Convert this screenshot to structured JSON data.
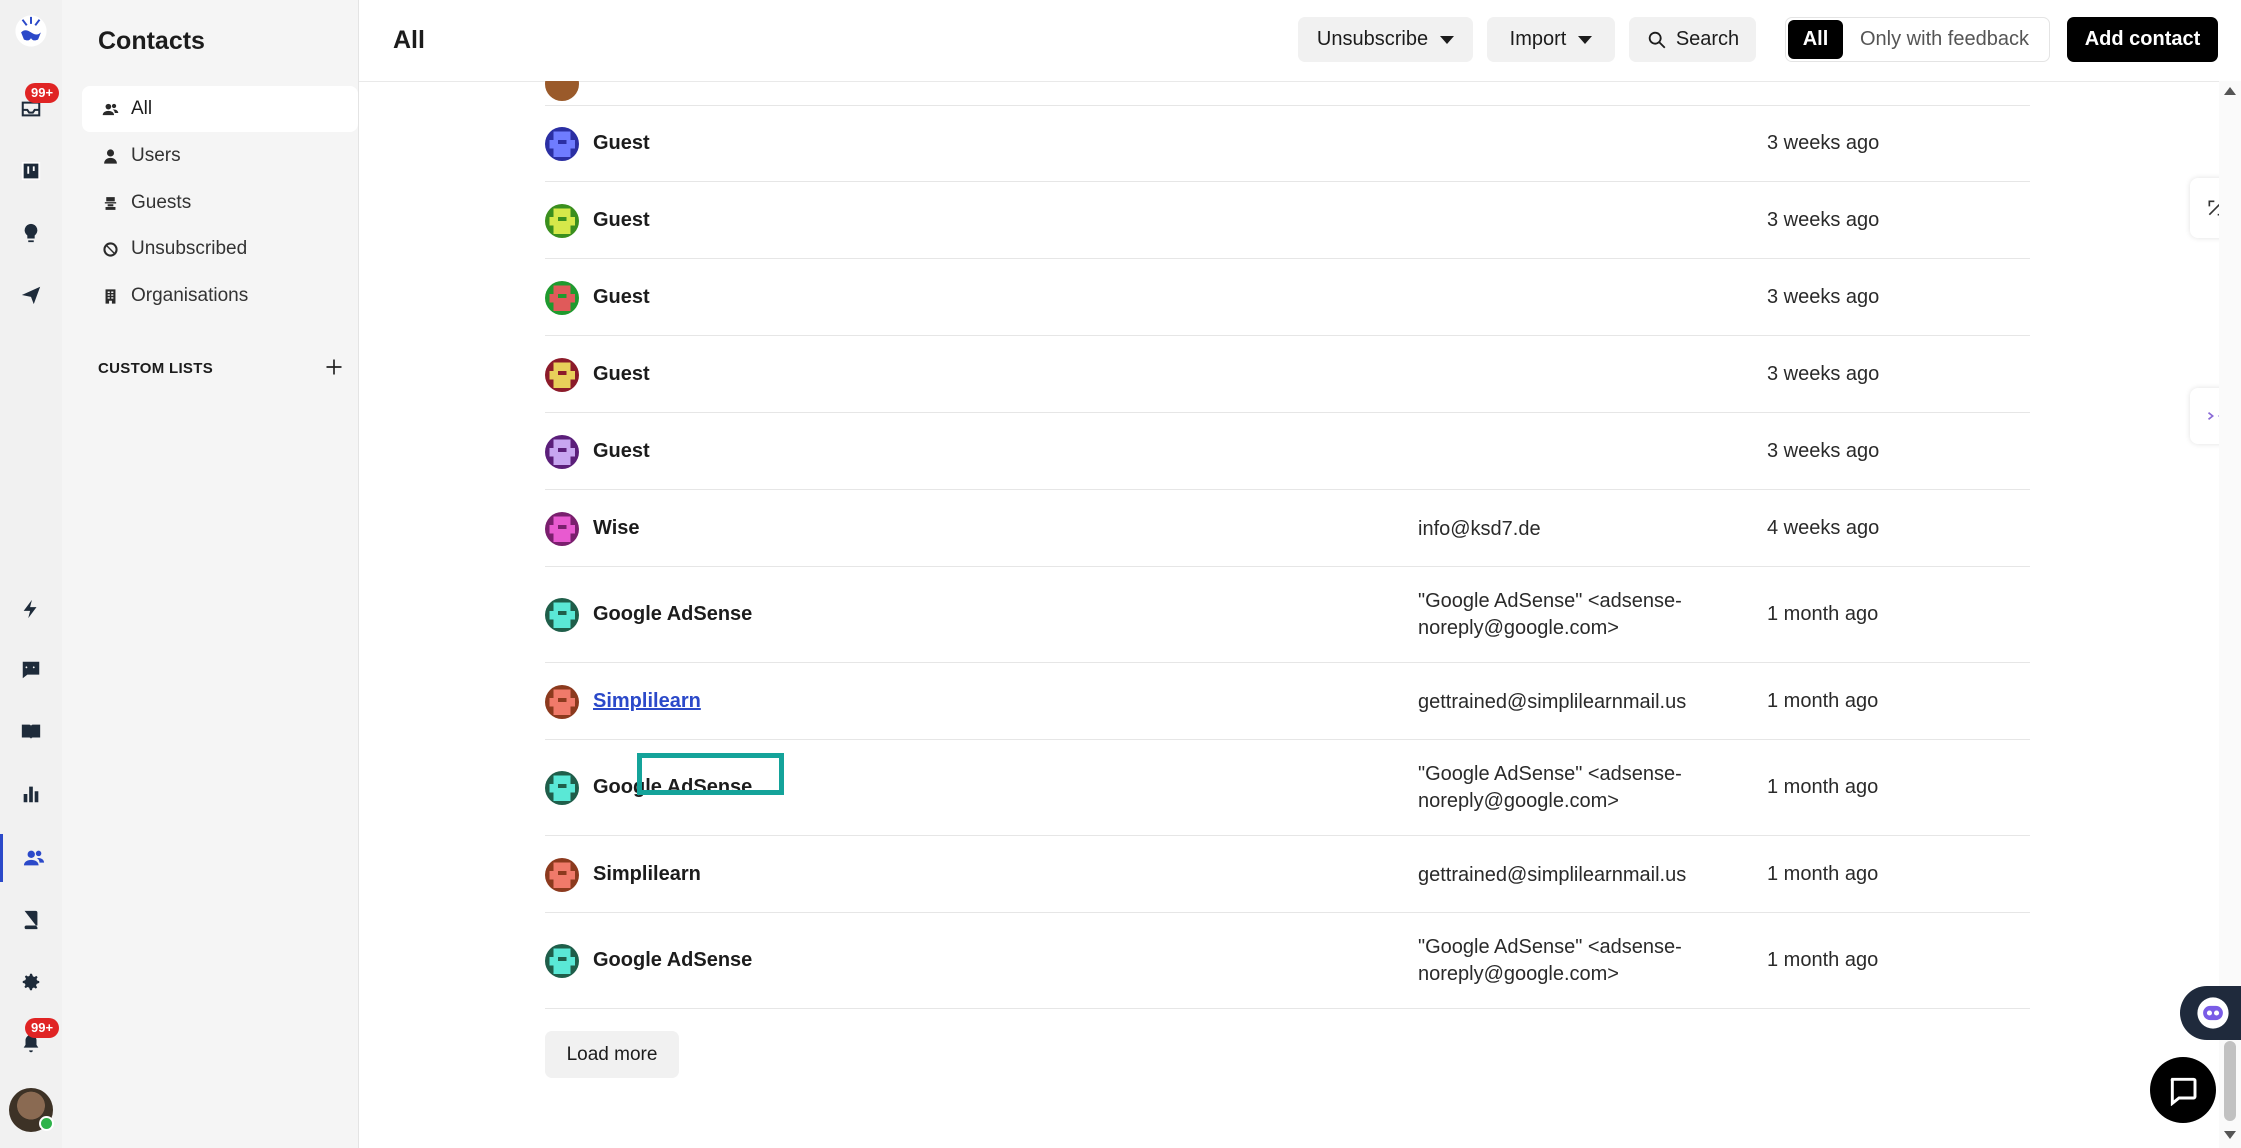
{
  "rail": {
    "inbox_badge": "99+",
    "notifications_badge": "99+"
  },
  "sidebar": {
    "title": "Contacts",
    "items": [
      {
        "label": "All"
      },
      {
        "label": "Users"
      },
      {
        "label": "Guests"
      },
      {
        "label": "Unsubscribed"
      },
      {
        "label": "Organisations"
      }
    ],
    "custom_lists_label": "CUSTOM LISTS"
  },
  "header": {
    "title": "All",
    "unsubscribe_label": "Unsubscribe",
    "import_label": "Import",
    "search_label": "Search",
    "filter_all": "All",
    "filter_feedback": "Only with feedback",
    "add_contact_label": "Add contact"
  },
  "contacts": [
    {
      "name": "Guest",
      "email": "",
      "time": "3 weeks ago",
      "avatar_bg": "#2b2fa3",
      "avatar_fg": "#6f7cff"
    },
    {
      "name": "Guest",
      "email": "",
      "time": "3 weeks ago",
      "avatar_bg": "#3a8f1e",
      "avatar_fg": "#d6e84a"
    },
    {
      "name": "Guest",
      "email": "",
      "time": "3 weeks ago",
      "avatar_bg": "#1f9a2e",
      "avatar_fg": "#e05a5a"
    },
    {
      "name": "Guest",
      "email": "",
      "time": "3 weeks ago",
      "avatar_bg": "#8c1b2a",
      "avatar_fg": "#e8d05a"
    },
    {
      "name": "Guest",
      "email": "",
      "time": "3 weeks ago",
      "avatar_bg": "#5b1f7a",
      "avatar_fg": "#c7a6f0"
    },
    {
      "name": "Wise",
      "email": "info@ksd7.de",
      "time": "4 weeks ago",
      "avatar_bg": "#7a1f6e",
      "avatar_fg": "#e85ad0"
    },
    {
      "name": "Google AdSense",
      "email": "\"Google AdSense\" <adsense-noreply@google.com>",
      "time": "1 month ago",
      "avatar_bg": "#1f5e4a",
      "avatar_fg": "#5ae8d6"
    },
    {
      "name": "Simplilearn",
      "email": "gettrained@simplilearnmail.us",
      "time": "1 month ago",
      "avatar_bg": "#8c3a1e",
      "avatar_fg": "#f07a6a",
      "link": true
    },
    {
      "name": "Google AdSense",
      "email": "\"Google AdSense\" <adsense-noreply@google.com>",
      "time": "1 month ago",
      "avatar_bg": "#1f5e4a",
      "avatar_fg": "#5ae8d6"
    },
    {
      "name": "Simplilearn",
      "email": "gettrained@simplilearnmail.us",
      "time": "1 month ago",
      "avatar_bg": "#8c3a1e",
      "avatar_fg": "#f07a6a"
    },
    {
      "name": "Google AdSense",
      "email": "\"Google AdSense\" <adsense-noreply@google.com>",
      "time": "1 month ago",
      "avatar_bg": "#1f5e4a",
      "avatar_fg": "#5ae8d6"
    }
  ],
  "load_more_label": "Load more",
  "colors": {
    "accent": "#2b49c9",
    "highlight": "#14a39a",
    "badge": "#e02424"
  }
}
